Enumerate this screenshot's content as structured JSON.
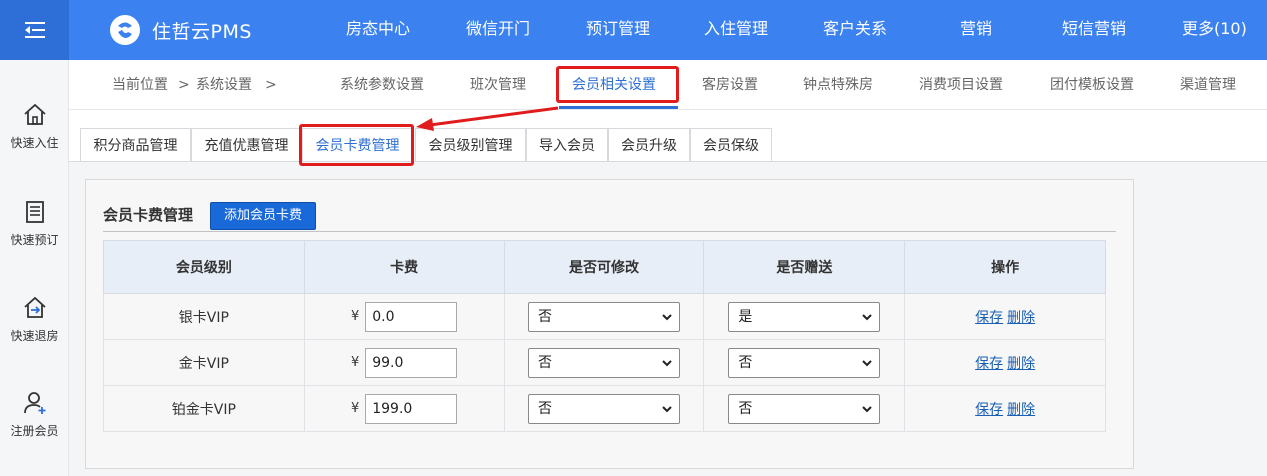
{
  "brand": {
    "name": "住哲云PMS"
  },
  "topnav": [
    "房态中心",
    "微信开门",
    "预订管理",
    "入住管理",
    "客户关系",
    "营销",
    "短信营销",
    "更多(10)"
  ],
  "sidebar": [
    {
      "label": "快速入住",
      "icon": "house-icon"
    },
    {
      "label": "快速预订",
      "icon": "document-icon"
    },
    {
      "label": "快速退房",
      "icon": "checkout-icon"
    },
    {
      "label": "注册会员",
      "icon": "add-user-icon"
    }
  ],
  "breadcrumb": {
    "current": "当前位置",
    "sep1": ">",
    "section": "系统设置",
    "sep2": ">"
  },
  "subnav": {
    "items": [
      "系统参数设置",
      "班次管理",
      "会员相关设置",
      "客房设置",
      "钟点特殊房",
      "消费项目设置",
      "团付模板设置",
      "渠道管理"
    ],
    "active": "会员相关设置"
  },
  "tabs": {
    "items": [
      "积分商品管理",
      "充值优惠管理",
      "会员卡费管理",
      "会员级别管理",
      "导入会员",
      "会员升级",
      "会员保级"
    ],
    "active": "会员卡费管理"
  },
  "panel": {
    "title": "会员卡费管理",
    "add_button": "添加会员卡费"
  },
  "table": {
    "headers": [
      "会员级别",
      "卡费",
      "是否可修改",
      "是否赠送",
      "操作"
    ],
    "currency": "¥",
    "rows": [
      {
        "level": "银卡VIP",
        "fee": "0.0",
        "modifiable": "否",
        "gift": "是",
        "save": "保存",
        "delete": "删除"
      },
      {
        "level": "金卡VIP",
        "fee": "99.0",
        "modifiable": "否",
        "gift": "否",
        "save": "保存",
        "delete": "删除"
      },
      {
        "level": "铂金卡VIP",
        "fee": "199.0",
        "modifiable": "否",
        "gift": "否",
        "save": "保存",
        "delete": "删除"
      }
    ]
  },
  "colors": {
    "topbar": "#3b82f0",
    "accent": "#2d6fd6",
    "highlight": "#e01c1c",
    "button": "#1a69d8"
  }
}
